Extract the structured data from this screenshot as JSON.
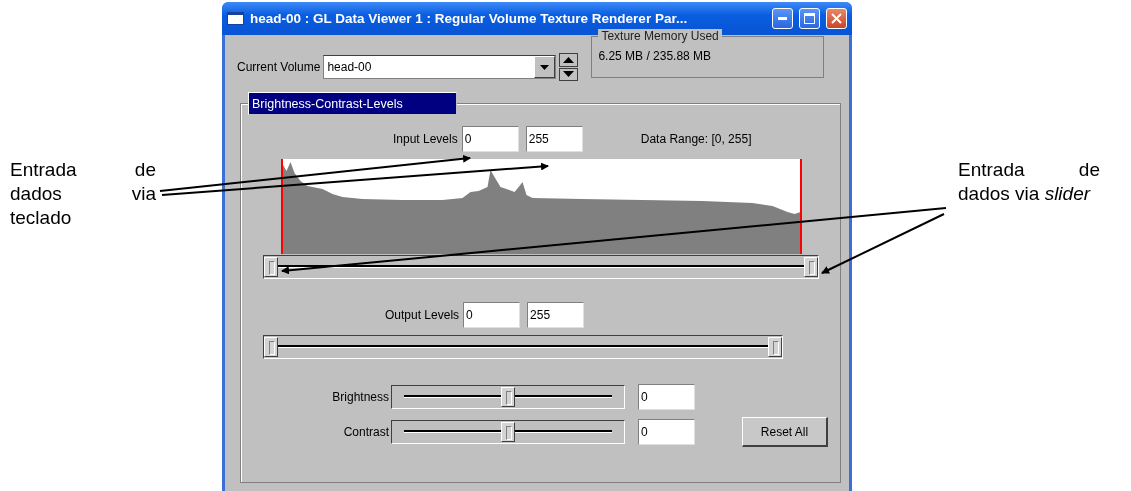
{
  "left_annotation": "Entrada de dados via teclado",
  "right_annotation": "Entrada de dados via *slider*",
  "window": {
    "title": "head-00 : GL Data Viewer 1 : Regular Volume Texture Renderer Par...",
    "current_volume": {
      "label": "Current Volume",
      "value": "head-00"
    },
    "texture_memory": {
      "title": "Texture Memory Used",
      "value": "6.25 MB / 235.88 MB"
    },
    "tab": {
      "label": "Brightness-Contrast-Levels",
      "selected": true
    },
    "input_levels": {
      "label": "Input Levels",
      "low": "0",
      "high": "255",
      "data_range": "Data Range: [0, 255]",
      "thumbs": [
        {
          "level": 0
        },
        {
          "level": 1
        }
      ]
    },
    "output_levels": {
      "label": "Output Levels",
      "low": "0",
      "high": "255",
      "thumbs": [
        {
          "level": 0
        },
        {
          "level": 1
        }
      ]
    },
    "adjustments": [
      {
        "label": "Brightness",
        "level": 0.5,
        "value": "0"
      },
      {
        "label": "Contrast",
        "level": 0.5,
        "value": "0"
      }
    ],
    "reset_button": "Reset All"
  }
}
